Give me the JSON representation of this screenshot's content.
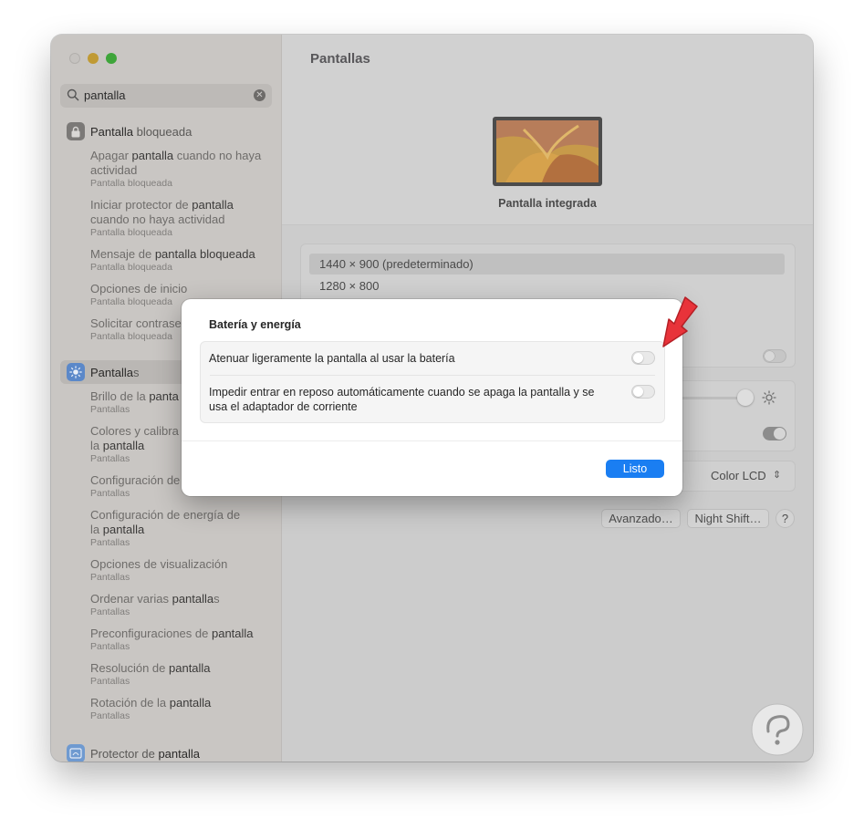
{
  "sidebar": {
    "search": {
      "value": "pantalla"
    },
    "groups": [
      {
        "title_plain": "",
        "title_bold": "Pantalla",
        "title_tail": " bloqueada",
        "icon": "lock-icon",
        "items": [
          {
            "pre": "Apagar ",
            "bold": "pantalla",
            "post": " cuando no haya actividad",
            "category": "Pantalla bloqueada"
          },
          {
            "pre": "Iniciar protector de ",
            "bold": "pantalla",
            "post": " cuando no haya actividad",
            "category": "Pantalla bloqueada"
          },
          {
            "pre": "Mensaje de ",
            "bold": "pantalla bloqueada",
            "post": "",
            "category": "Pantalla bloqueada"
          },
          {
            "pre": "Opciones de inicio",
            "bold": "",
            "post": "",
            "category": "Pantalla bloqueada"
          },
          {
            "pre": "Solicitar contrase",
            "bold": "",
            "post": "",
            "category": "Pantalla bloqueada"
          }
        ]
      },
      {
        "title_plain": "",
        "title_bold": "Pantalla",
        "title_tail": "s",
        "icon": "sun-icon",
        "items": [
          {
            "pre": "Brillo de la ",
            "bold": "panta",
            "post": "",
            "category": "Pantallas"
          },
          {
            "pre": "Colores y calibra",
            "bold": "",
            "post": "",
            "line2_pre": "la ",
            "line2_bold": "pantalla",
            "category": "Pantallas"
          },
          {
            "pre": "Configuración de",
            "bold": "",
            "post": "",
            "category": "Pantallas"
          },
          {
            "pre": "Configuración de energía de",
            "bold": "",
            "post": "",
            "line2_pre": "la ",
            "line2_bold": "pantalla",
            "category": "Pantallas"
          },
          {
            "pre": "Opciones de visualización",
            "bold": "",
            "post": "",
            "category": "Pantallas"
          },
          {
            "pre": "Ordenar varias ",
            "bold": "pantalla",
            "post": "s",
            "category": "Pantallas"
          },
          {
            "pre": "Preconfiguraciones de ",
            "bold": "pantalla",
            "post": "",
            "category": "Pantallas"
          },
          {
            "pre": "Resolución de ",
            "bold": "pantalla",
            "post": "",
            "category": "Pantallas"
          },
          {
            "pre": "Rotación de la ",
            "bold": "pantalla",
            "post": "",
            "category": "Pantallas"
          }
        ]
      },
      {
        "title_plain": "Protector de ",
        "title_bold": "pantalla",
        "title_tail": "",
        "icon": "screensaver-icon",
        "items": []
      }
    ]
  },
  "main": {
    "title": "Pantallas",
    "display_name": "Pantalla integrada",
    "resolutions": [
      "1440 × 900 (predeterminado)",
      "1280 × 800"
    ],
    "color_profile": "Color LCD",
    "advanced_label": "Avanzado…",
    "night_shift_label": "Night Shift…",
    "help_label": "?"
  },
  "modal": {
    "title": "Batería y energía",
    "option1": "Atenuar ligeramente la pantalla al usar la batería",
    "option2": "Impedir entrar en reposo automáticamente cuando se apaga la pantalla y se usa el adaptador de corriente",
    "option1_on": false,
    "option2_on": false,
    "done_label": "Listo"
  },
  "colors": {
    "accent": "#1a7ef2",
    "arrow": "#e8333a",
    "close": "#c5c2bf",
    "minimize": "#c09a34",
    "maximize": "#3ea53a"
  }
}
